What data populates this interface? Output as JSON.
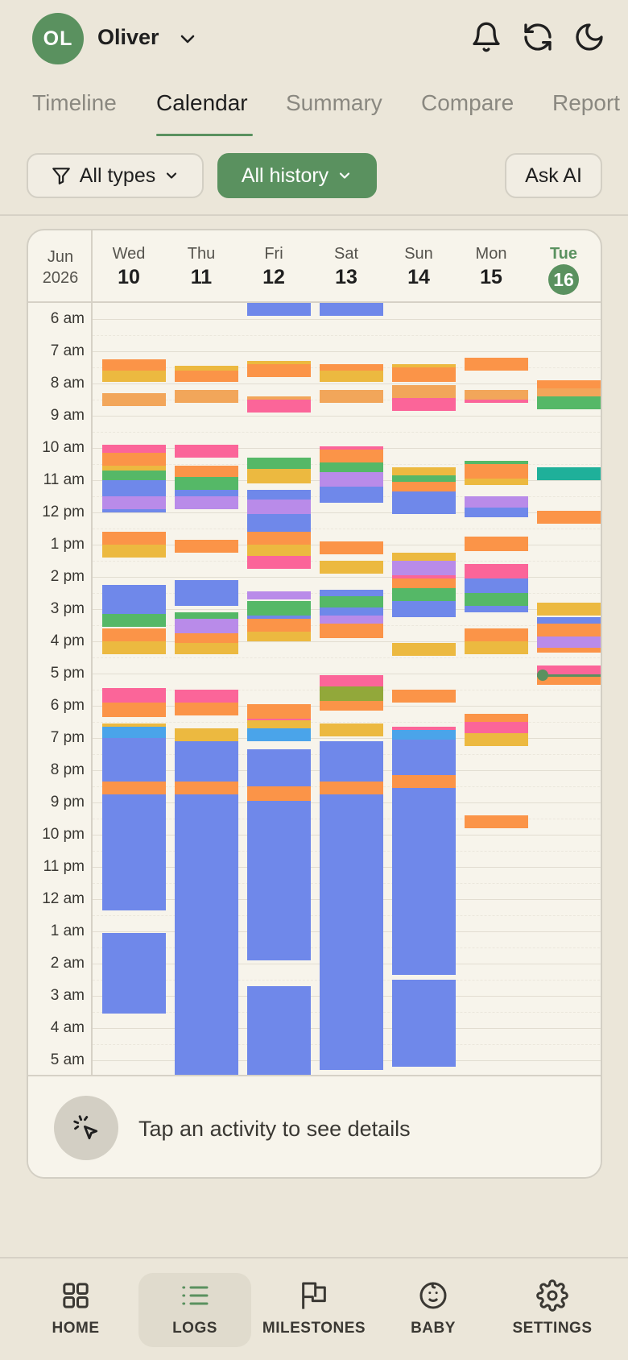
{
  "user": {
    "initials": "OL",
    "name": "Oliver"
  },
  "header_icons": [
    "bell-icon",
    "refresh-icon",
    "moon-icon"
  ],
  "tabs": [
    {
      "label": "Timeline",
      "active": false
    },
    {
      "label": "Calendar",
      "active": true
    },
    {
      "label": "Summary",
      "active": false
    },
    {
      "label": "Compare",
      "active": false
    },
    {
      "label": "Report",
      "active": false
    }
  ],
  "filters": {
    "types_label": "All types",
    "history_label": "All history",
    "ask_ai_label": "Ask AI"
  },
  "calendar": {
    "month": "Jun",
    "year": "2026",
    "days": [
      {
        "name": "Wed",
        "date": "10"
      },
      {
        "name": "Thu",
        "date": "11"
      },
      {
        "name": "Fri",
        "date": "12"
      },
      {
        "name": "Sat",
        "date": "13"
      },
      {
        "name": "Sun",
        "date": "14"
      },
      {
        "name": "Mon",
        "date": "15"
      },
      {
        "name": "Tue",
        "date": "16",
        "today": true
      }
    ],
    "times": [
      "6 am",
      "7 am",
      "8 am",
      "9 am",
      "10 am",
      "11 am",
      "12 pm",
      "1 pm",
      "2 pm",
      "3 pm",
      "4 pm",
      "5 pm",
      "6 pm",
      "7 pm",
      "8 pm",
      "9 pm",
      "10 pm",
      "11 pm",
      "12 am",
      "1 am",
      "2 am",
      "3 am",
      "4 am",
      "5 am"
    ],
    "start_hour": 5.5,
    "now_hour": 17.05,
    "colors": {
      "sleep": "#6f88ea",
      "feed": "#fb9448",
      "bottle": "#ecb940",
      "solids": "#f2a65a",
      "diaper": "#fb6599",
      "play": "#55b867",
      "bath": "#b98be9",
      "med": "#1fb09a",
      "pump": "#4aa4ea",
      "walk": "#92a83a"
    },
    "events": [
      [
        [
          "feed",
          7.25,
          7.6
        ],
        [
          "bottle",
          7.6,
          7.95
        ],
        [
          "solids",
          8.3,
          8.7
        ],
        [
          "diaper",
          9.9,
          10.15
        ],
        [
          "feed",
          10.15,
          10.55
        ],
        [
          "bottle",
          10.55,
          10.7
        ],
        [
          "play",
          10.7,
          11
        ],
        [
          "sleep",
          11,
          11.5
        ],
        [
          "bath",
          11.5,
          11.9
        ],
        [
          "sleep",
          11.9,
          12
        ],
        [
          "feed",
          12.6,
          13
        ],
        [
          "bottle",
          13,
          13.4
        ],
        [
          "sleep",
          14.25,
          15.15
        ],
        [
          "play",
          15.15,
          15.55
        ],
        [
          "feed",
          15.6,
          16
        ],
        [
          "bottle",
          16,
          16.4
        ],
        [
          "diaper",
          17.45,
          17.9
        ],
        [
          "feed",
          17.9,
          18.35
        ],
        [
          "bottle",
          18.55,
          18.65
        ],
        [
          "pump",
          18.65,
          19
        ],
        [
          "sleep",
          19,
          20.35
        ],
        [
          "feed",
          20.35,
          20.75
        ],
        [
          "sleep",
          20.75,
          24.35
        ],
        [
          "sleep",
          25.05,
          27.55
        ]
      ],
      [
        [
          "bottle",
          7.45,
          7.6
        ],
        [
          "feed",
          7.6,
          7.95
        ],
        [
          "solids",
          8.2,
          8.6
        ],
        [
          "diaper",
          9.9,
          10.3
        ],
        [
          "feed",
          10.55,
          10.9
        ],
        [
          "play",
          10.9,
          11.3
        ],
        [
          "sleep",
          11.3,
          11.5
        ],
        [
          "bath",
          11.5,
          11.9
        ],
        [
          "feed",
          12.85,
          13.25
        ],
        [
          "sleep",
          14.1,
          14.9
        ],
        [
          "play",
          15.1,
          15.3
        ],
        [
          "bath",
          15.3,
          15.75
        ],
        [
          "feed",
          15.75,
          16.05
        ],
        [
          "bottle",
          16.05,
          16.4
        ],
        [
          "diaper",
          17.5,
          17.9
        ],
        [
          "feed",
          17.9,
          18.3
        ],
        [
          "bottle",
          18.7,
          19.1
        ],
        [
          "sleep",
          19.1,
          20.35
        ],
        [
          "feed",
          20.35,
          20.75
        ],
        [
          "sleep",
          20.75,
          26.4
        ],
        [
          "sleep",
          26.4,
          29.5
        ]
      ],
      [
        [
          "sleep",
          5.5,
          5.9
        ],
        [
          "bottle",
          7.3,
          7.4
        ],
        [
          "feed",
          7.4,
          7.8
        ],
        [
          "solids",
          8.4,
          8.5
        ],
        [
          "diaper",
          8.5,
          8.9
        ],
        [
          "play",
          10.3,
          10.65
        ],
        [
          "bottle",
          10.65,
          11.1
        ],
        [
          "sleep",
          11.3,
          11.6
        ],
        [
          "bath",
          11.6,
          12.05
        ],
        [
          "sleep",
          12.05,
          12.6
        ],
        [
          "feed",
          12.6,
          13
        ],
        [
          "bottle",
          13,
          13.35
        ],
        [
          "diaper",
          13.35,
          13.75
        ],
        [
          "bath",
          14.45,
          14.7
        ],
        [
          "play",
          14.75,
          15.2
        ],
        [
          "sleep",
          15.2,
          15.3
        ],
        [
          "feed",
          15.3,
          15.7
        ],
        [
          "bottle",
          15.7,
          16
        ],
        [
          "feed",
          17.95,
          18.4
        ],
        [
          "diaper",
          18.4,
          18.45
        ],
        [
          "bottle",
          18.45,
          18.7
        ],
        [
          "pump",
          18.7,
          19.1
        ],
        [
          "sleep",
          19.35,
          20.5
        ],
        [
          "feed",
          20.5,
          20.95
        ],
        [
          "sleep",
          20.95,
          25.9
        ],
        [
          "sleep",
          26.7,
          29.6
        ]
      ],
      [
        [
          "sleep",
          5.5,
          5.9
        ],
        [
          "feed",
          7.4,
          7.6
        ],
        [
          "bottle",
          7.6,
          7.95
        ],
        [
          "solids",
          8.2,
          8.6
        ],
        [
          "diaper",
          9.95,
          10.05
        ],
        [
          "feed",
          10.05,
          10.45
        ],
        [
          "play",
          10.45,
          10.75
        ],
        [
          "bath",
          10.75,
          11.2
        ],
        [
          "sleep",
          11.2,
          11.7
        ],
        [
          "feed",
          12.9,
          13.3
        ],
        [
          "bottle",
          13.5,
          13.9
        ],
        [
          "sleep",
          14.4,
          14.6
        ],
        [
          "play",
          14.6,
          14.95
        ],
        [
          "sleep",
          14.95,
          15.2
        ],
        [
          "bath",
          15.2,
          15.45
        ],
        [
          "feed",
          15.45,
          15.9
        ],
        [
          "diaper",
          17.05,
          17.4
        ],
        [
          "walk",
          17.4,
          17.85
        ],
        [
          "feed",
          17.85,
          18.15
        ],
        [
          "bottle",
          18.55,
          18.95
        ],
        [
          "sleep",
          19.1,
          20.35
        ],
        [
          "feed",
          20.35,
          20.75
        ],
        [
          "sleep",
          20.75,
          26.15
        ],
        [
          "sleep",
          26,
          29.3
        ]
      ],
      [
        [
          "bottle",
          7.4,
          7.5
        ],
        [
          "feed",
          7.5,
          7.95
        ],
        [
          "solids",
          8.05,
          8.45
        ],
        [
          "diaper",
          8.45,
          8.85
        ],
        [
          "bottle",
          10.6,
          10.85
        ],
        [
          "play",
          10.85,
          11.05
        ],
        [
          "feed",
          11.05,
          11.35
        ],
        [
          "sleep",
          11.35,
          12.05
        ],
        [
          "bottle",
          13.25,
          13.5
        ],
        [
          "bath",
          13.5,
          13.95
        ],
        [
          "diaper",
          13.95,
          14.05
        ],
        [
          "feed",
          14.05,
          14.35
        ],
        [
          "play",
          14.35,
          14.75
        ],
        [
          "sleep",
          14.75,
          15.25
        ],
        [
          "bottle",
          16.05,
          16.45
        ],
        [
          "feed",
          17.5,
          17.9
        ],
        [
          "diaper",
          18.65,
          18.75
        ],
        [
          "pump",
          18.75,
          19.05
        ],
        [
          "sleep",
          19.05,
          20.15
        ],
        [
          "feed",
          20.15,
          20.55
        ],
        [
          "sleep",
          20.55,
          26.35
        ],
        [
          "sleep",
          26.5,
          29.2
        ]
      ],
      [
        [
          "feed",
          7.2,
          7.6
        ],
        [
          "solids",
          8.2,
          8.5
        ],
        [
          "diaper",
          8.5,
          8.6
        ],
        [
          "play",
          10.4,
          10.5
        ],
        [
          "feed",
          10.5,
          10.95
        ],
        [
          "bottle",
          10.95,
          11.15
        ],
        [
          "bath",
          11.5,
          11.85
        ],
        [
          "sleep",
          11.85,
          12.15
        ],
        [
          "feed",
          12.75,
          13.2
        ],
        [
          "diaper",
          13.6,
          14.05
        ],
        [
          "sleep",
          14.05,
          14.5
        ],
        [
          "play",
          14.5,
          14.9
        ],
        [
          "sleep",
          14.9,
          15.1
        ],
        [
          "feed",
          15.6,
          16
        ],
        [
          "bottle",
          16,
          16.4
        ],
        [
          "feed",
          18.25,
          18.5
        ],
        [
          "diaper",
          18.5,
          18.85
        ],
        [
          "bottle",
          18.85,
          19.25
        ],
        [
          "feed",
          21.4,
          21.8
        ]
      ],
      [
        [
          "feed",
          7.9,
          8.15
        ],
        [
          "solids",
          8.15,
          8.4
        ],
        [
          "play",
          8.4,
          8.8
        ],
        [
          "med",
          10.6,
          11
        ],
        [
          "feed",
          11.95,
          12.35
        ],
        [
          "bottle",
          14.8,
          15.2
        ],
        [
          "sleep",
          15.25,
          15.45
        ],
        [
          "feed",
          15.45,
          15.85
        ],
        [
          "bath",
          15.85,
          16.2
        ],
        [
          "feed",
          16.2,
          16.35
        ],
        [
          "diaper",
          16.75,
          17.1
        ],
        [
          "feed",
          17.1,
          17.35
        ]
      ]
    ],
    "detail_text": "Tap an activity to see details"
  },
  "nav": [
    {
      "label": "HOME",
      "icon": "grid-icon",
      "active": false
    },
    {
      "label": "LOGS",
      "icon": "list-icon",
      "active": true
    },
    {
      "label": "MILESTONES",
      "icon": "flag-icon",
      "active": false
    },
    {
      "label": "BABY",
      "icon": "baby-face-icon",
      "active": false
    },
    {
      "label": "SETTINGS",
      "icon": "gear-icon",
      "active": false
    }
  ]
}
